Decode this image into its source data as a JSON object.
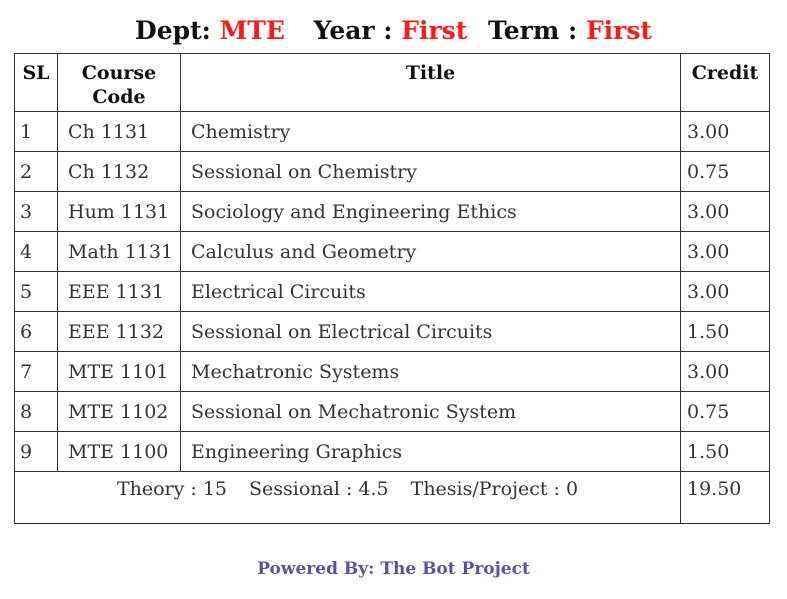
{
  "heading": {
    "dept_label": "Dept:",
    "dept_value": "MTE",
    "year_label": "Year :",
    "year_value": "First",
    "term_label": "Term :",
    "term_value": "First"
  },
  "table": {
    "headers": {
      "sl": "SL",
      "code_line1": "Course",
      "code_line2": "Code",
      "title": "Title",
      "credit": "Credit"
    },
    "rows": [
      {
        "sl": "1",
        "code": "Ch 1131",
        "title": "Chemistry",
        "credit": "3.00"
      },
      {
        "sl": "2",
        "code": "Ch 1132",
        "title": "Sessional on Chemistry",
        "credit": "0.75"
      },
      {
        "sl": "3",
        "code": "Hum 1131",
        "title": "Sociology and Engineering Ethics",
        "credit": "3.00"
      },
      {
        "sl": "4",
        "code": "Math 1131",
        "title": "Calculus and Geometry",
        "credit": "3.00"
      },
      {
        "sl": "5",
        "code": "EEE 1131",
        "title": "Electrical Circuits",
        "credit": "3.00"
      },
      {
        "sl": "6",
        "code": "EEE 1132",
        "title": "Sessional on Electrical Circuits",
        "credit": "1.50"
      },
      {
        "sl": "7",
        "code": "MTE 1101",
        "title": "Mechatronic Systems",
        "credit": "3.00"
      },
      {
        "sl": "8",
        "code": "MTE 1102",
        "title": "Sessional on Mechatronic System",
        "credit": "0.75"
      },
      {
        "sl": "9",
        "code": "MTE 1100",
        "title": "Engineering Graphics",
        "credit": "1.50"
      }
    ],
    "summary": {
      "theory": "Theory : 15",
      "sessional": "Sessional : 4.5",
      "thesis": "Thesis/Project : 0",
      "total_credit": "19.50"
    }
  },
  "footer": {
    "text": "Powered By: The Bot Project"
  },
  "colors": {
    "highlight": "#ff1a1a",
    "footer": "#5e4fa3",
    "border": "#333333"
  }
}
